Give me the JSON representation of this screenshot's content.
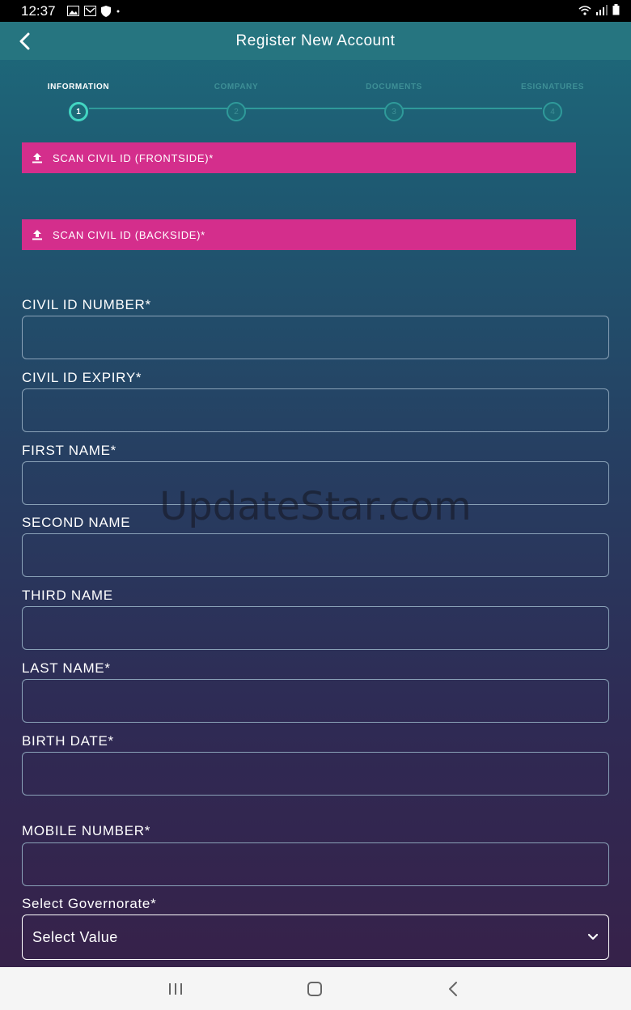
{
  "status_bar": {
    "time": "12:37",
    "icons": [
      "gallery-icon",
      "mail-icon",
      "shield-icon",
      "dot-icon",
      "wifi-icon",
      "signal-icon",
      "battery-icon"
    ]
  },
  "header": {
    "title": "Register New Account",
    "back_icon": "chevron-left-icon"
  },
  "stepper": {
    "steps": [
      {
        "label": "INFORMATION",
        "number": "1",
        "active": true
      },
      {
        "label": "COMPANY",
        "number": "2",
        "active": false
      },
      {
        "label": "DOCUMENTS",
        "number": "3",
        "active": false
      },
      {
        "label": "ESIGNATURES",
        "number": "4",
        "active": false
      }
    ]
  },
  "uploads": {
    "front_label": "SCAN CIVIL ID (FRONTSIDE)*",
    "back_label": "SCAN CIVIL ID (BACKSIDE)*",
    "icon": "upload-icon"
  },
  "form": {
    "civil_id_number": {
      "label": "CIVIL ID NUMBER*",
      "value": ""
    },
    "civil_id_expiry": {
      "label": "CIVIL ID EXPIRY*",
      "value": ""
    },
    "first_name": {
      "label": "FIRST NAME*",
      "value": ""
    },
    "second_name": {
      "label": "SECOND NAME",
      "value": ""
    },
    "third_name": {
      "label": "THIRD NAME",
      "value": ""
    },
    "last_name": {
      "label": "LAST NAME*",
      "value": ""
    },
    "birth_date": {
      "label": "BIRTH DATE*",
      "value": ""
    },
    "mobile_number": {
      "label": "MOBILE NUMBER*",
      "value": ""
    },
    "governorate": {
      "label": "Select Governorate*",
      "selected": "Select Value"
    }
  },
  "watermark": "UpdateStar.com",
  "colors": {
    "accent_pink": "#d42e8c",
    "active_step": "#42d6c2",
    "appbar": "#267580"
  },
  "nav_bar": {
    "icons": [
      "recents-icon",
      "home-icon",
      "back-icon"
    ]
  }
}
